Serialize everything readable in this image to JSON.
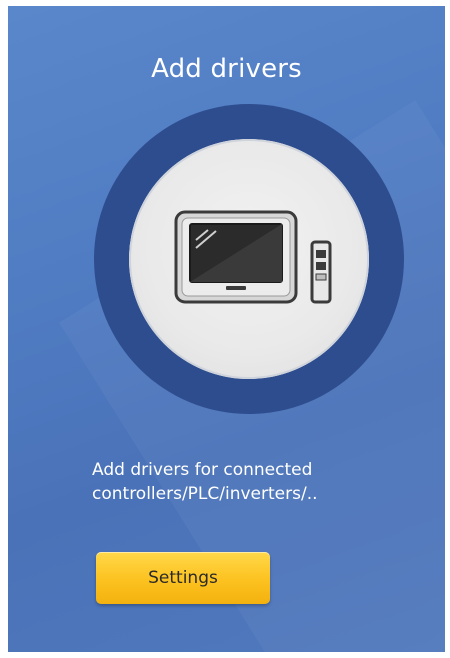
{
  "card": {
    "title": "Add drivers",
    "illustration_icon": "hmi-panel-with-controller-icon",
    "description_line1": "Add drivers for connected",
    "description_line2": "controllers/PLC/inverters/..",
    "settings_button_label": "Settings"
  },
  "colors": {
    "panel_background": "#4f7bc2",
    "ring": "#2e4d8e",
    "disc": "#ececec",
    "button": "#fcc21f",
    "text_light": "#ffffff",
    "button_text": "#2a2a2a"
  }
}
